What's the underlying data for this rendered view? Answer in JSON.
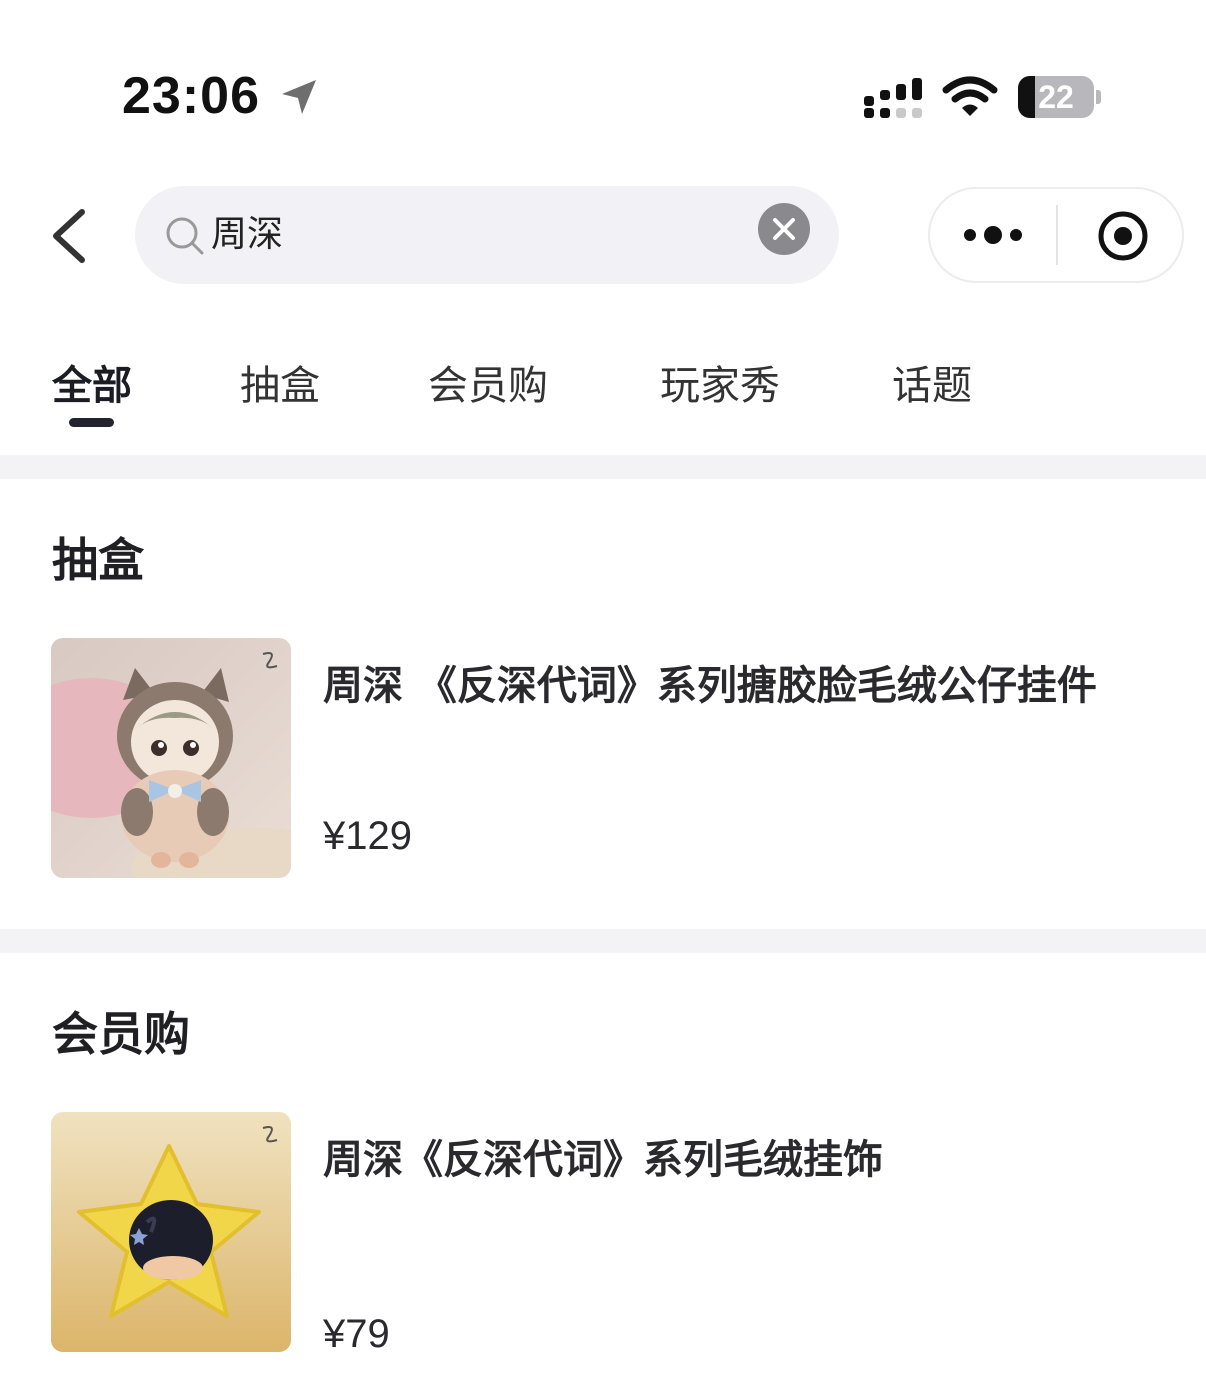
{
  "status_bar": {
    "time": "23:06",
    "battery_level": "22",
    "battery_fraction": 0.22
  },
  "search": {
    "query": "周深"
  },
  "tabs": [
    {
      "label": "全部",
      "active": true
    },
    {
      "label": "抽盒",
      "active": false
    },
    {
      "label": "会员购",
      "active": false
    },
    {
      "label": "玩家秀",
      "active": false
    },
    {
      "label": "话题",
      "active": false
    }
  ],
  "sections": [
    {
      "title": "抽盒",
      "products": [
        {
          "name": "周深 《反深代词》系列搪胶脸毛绒公仔挂件",
          "price": "¥129",
          "image": "plush-doll-cat-hood"
        }
      ]
    },
    {
      "title": "会员购",
      "products": [
        {
          "name": "周深《反深代词》系列毛绒挂饰",
          "price": "¥79",
          "image": "plush-star-charm"
        }
      ]
    }
  ],
  "colors": {
    "background": "#ffffff",
    "search_bg": "#f2f2f6",
    "divider": "#f3f3f6",
    "text": "#222222",
    "indicator": "#23232e"
  }
}
